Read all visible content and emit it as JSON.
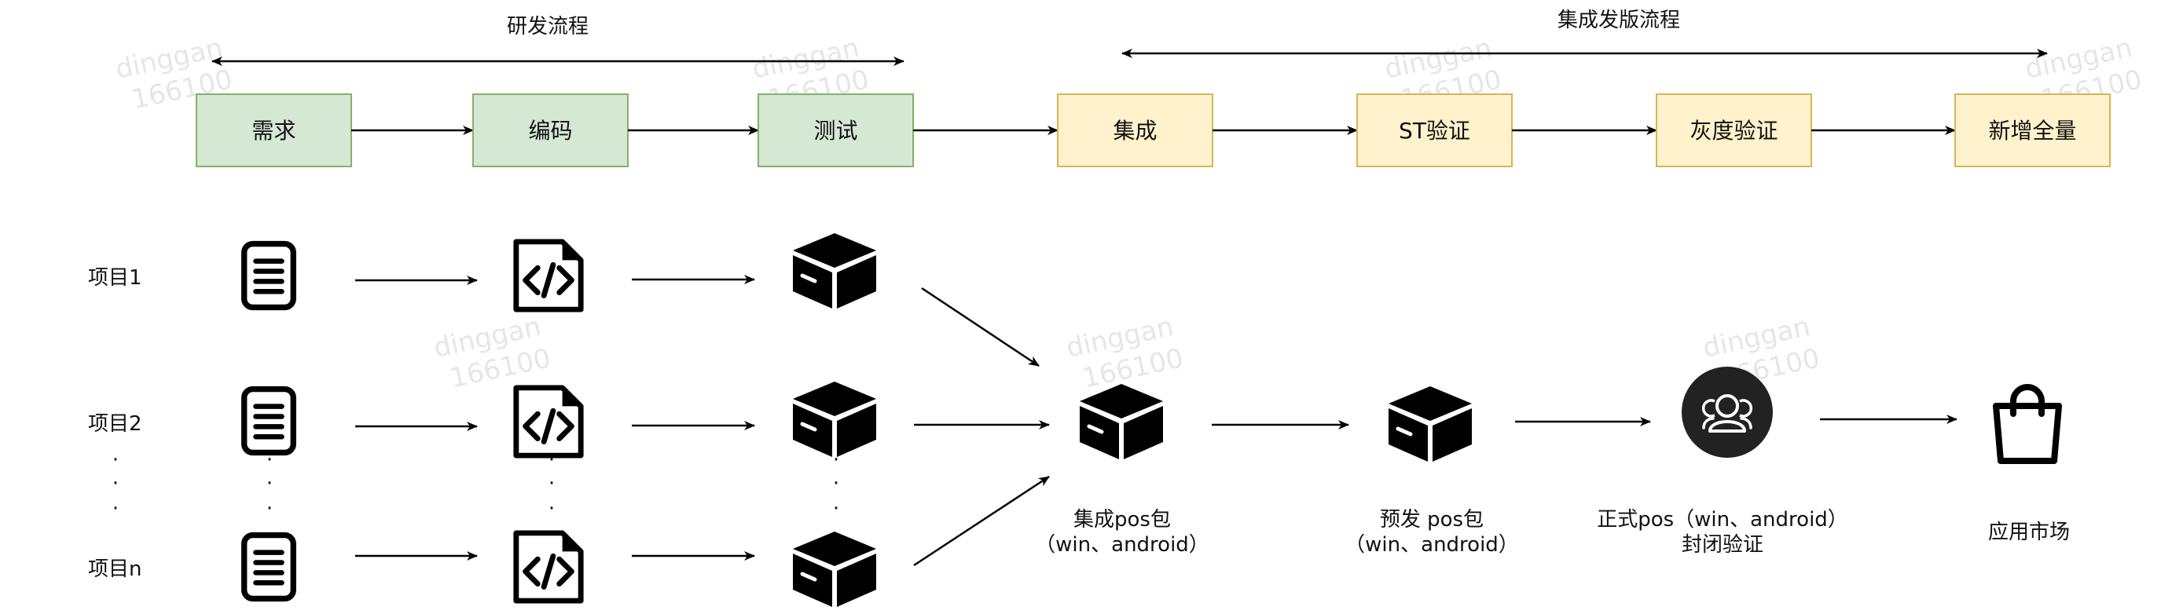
{
  "phases": {
    "dev": "研发流程",
    "release": "集成发版流程"
  },
  "stages": [
    {
      "label": "需求",
      "kind": "dev"
    },
    {
      "label": "编码",
      "kind": "dev"
    },
    {
      "label": "测试",
      "kind": "dev"
    },
    {
      "label": "集成",
      "kind": "release"
    },
    {
      "label": "ST验证",
      "kind": "release"
    },
    {
      "label": "灰度验证",
      "kind": "release"
    },
    {
      "label": "新增全量",
      "kind": "release"
    }
  ],
  "projects": [
    "项目1",
    "项目2",
    "项目n"
  ],
  "ellipsis": "·",
  "outputs": [
    {
      "line1": "集成pos包",
      "line2": "（win、android）"
    },
    {
      "line1": "预发 pos包",
      "line2": "（win、android）"
    },
    {
      "line1": "正式pos（win、android）",
      "line2": "封闭验证"
    },
    {
      "line1": "应用市场",
      "line2": ""
    }
  ],
  "icons": {
    "requirement": "document-icon",
    "code": "code-file-icon",
    "package": "package-box-icon",
    "users": "users-group-icon",
    "store": "shopping-bag-icon"
  },
  "watermark": {
    "line1": "dinggan",
    "line2": "166100"
  },
  "colors": {
    "dev_fill": "#d5e8d4",
    "dev_stroke": "#82b366",
    "release_fill": "#fff2cc",
    "release_stroke": "#d6b656",
    "ink": "#000000"
  }
}
